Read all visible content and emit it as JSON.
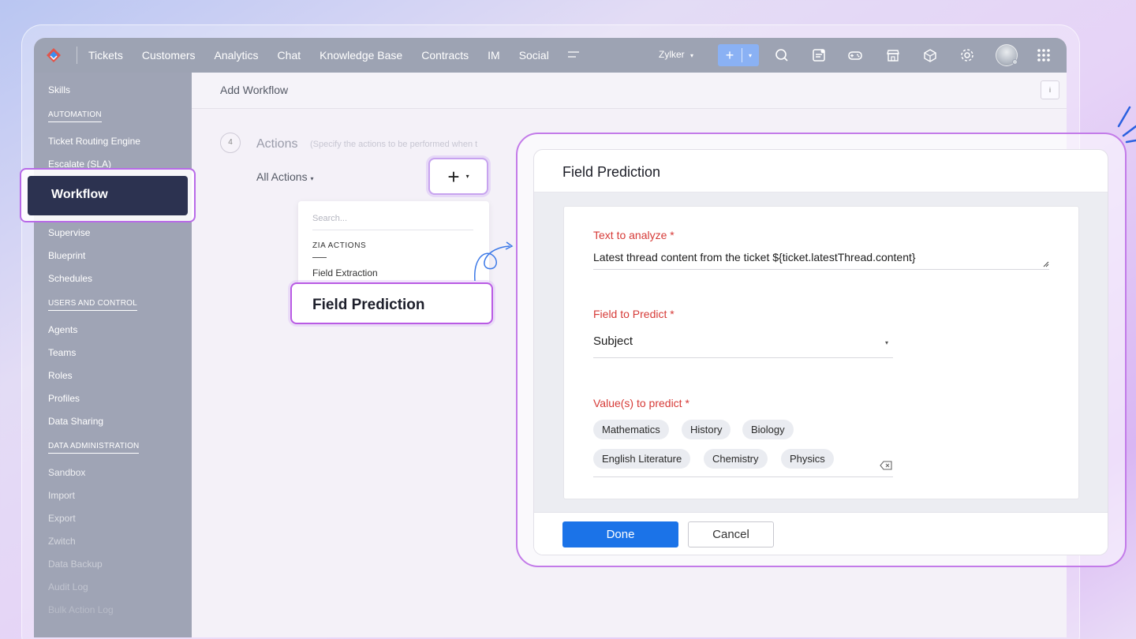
{
  "topbar": {
    "nav": [
      "Tickets",
      "Customers",
      "Analytics",
      "Chat",
      "Knowledge Base",
      "Contracts",
      "IM",
      "Social"
    ],
    "more_icon": "menu-lines-icon",
    "org": "Zylker",
    "org_caret": "▾",
    "add_plus": "+",
    "add_caret": "▾",
    "icons": [
      "search-icon",
      "notes-icon",
      "gamepad-icon",
      "store-icon",
      "box-icon",
      "gear-icon",
      "avatar",
      "apps-grid-icon"
    ]
  },
  "sidebar": {
    "items_top": [
      "Skills"
    ],
    "automation_header": "AUTOMATION",
    "automation_items": [
      "Ticket Routing Engine",
      "Escalate (SLA)"
    ],
    "workflow": "Workflow",
    "automation_items_after": [
      "Supervise",
      "Blueprint",
      "Schedules"
    ],
    "users_header": "USERS AND CONTROL",
    "users_items": [
      "Agents",
      "Teams",
      "Roles",
      "Profiles",
      "Data Sharing"
    ],
    "data_header": "DATA ADMINISTRATION",
    "data_items": [
      "Sandbox",
      "Import",
      "Export",
      "Zwitch",
      "Data Backup",
      "Audit Log",
      "Bulk Action Log"
    ]
  },
  "content": {
    "title": "Add Workflow",
    "info": "i",
    "step_number": "4",
    "step_title": "Actions",
    "step_hint": "(Specify the actions to be performed when t",
    "all_actions": "All Actions",
    "all_actions_caret": "▾",
    "plus_dropdown": {
      "plus": "+",
      "caret": "▾"
    }
  },
  "menu": {
    "search_placeholder": "Search...",
    "group": "ZIA ACTIONS",
    "item": "Field Extraction",
    "highlight": "Field Prediction"
  },
  "modal": {
    "title": "Field Prediction",
    "text_label": "Text to analyze *",
    "text_value": "Latest thread content from the ticket ${ticket.latestThread.content}",
    "field_label": "Field to Predict *",
    "field_value": "Subject",
    "field_caret": "▾",
    "values_label": "Value(s) to predict *",
    "chips": [
      "Mathematics",
      "History",
      "Biology",
      "English Literature",
      "Chemistry",
      "Physics"
    ],
    "done": "Done",
    "cancel": "Cancel"
  },
  "colors": {
    "topbar": "#9da3b3",
    "sidebar": "#9fa4b5",
    "workflow_active": "#2c3250",
    "required_label": "#d63a37",
    "primary": "#1b73e8",
    "highlight_border": "#b95be4"
  }
}
